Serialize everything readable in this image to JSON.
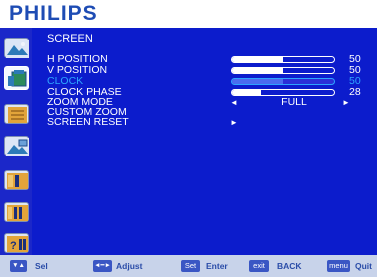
{
  "brand": "PHILIPS",
  "screen": {
    "title": "SCREEN",
    "rows": [
      {
        "label": "H POSITION",
        "value": "50",
        "fill_fraction": 0.5
      },
      {
        "label": "V POSITION",
        "value": "50",
        "fill_fraction": 0.5
      },
      {
        "label": "CLOCK",
        "value": "50",
        "fill_fraction": 0.5,
        "selected": true
      },
      {
        "label": "CLOCK PHASE",
        "value": "28",
        "fill_fraction": 0.28
      }
    ],
    "zoom_mode": {
      "label": "ZOOM MODE",
      "value": "FULL",
      "left_arrow": "◄",
      "right_arrow": "►"
    },
    "custom_zoom": {
      "label": "CUSTOM ZOOM"
    },
    "screen_reset": {
      "label": "SCREEN RESET",
      "arrow": "►"
    }
  },
  "sidebar": {
    "items": [
      {
        "name": "picture-icon"
      },
      {
        "name": "screen-icon",
        "active": true
      },
      {
        "name": "audio-icon"
      },
      {
        "name": "pip-icon"
      },
      {
        "name": "configuration1-icon"
      },
      {
        "name": "configuration2-icon"
      },
      {
        "name": "advanced-option-icon"
      }
    ]
  },
  "footer": {
    "sel_key": "▼▲",
    "sel_label": "Sel",
    "adjust_key": "◄━►",
    "adjust_label": "Adjust",
    "set_key": "Set",
    "enter_label": "Enter",
    "exit_key": "exit",
    "back_label": "BACK",
    "menu_key": "menu",
    "quit_label": "Quit"
  },
  "colors": {
    "background": "#0c1ccc",
    "selected": "#2ea4ff",
    "brand": "#1e4cb4",
    "footer": "#c8d3ea"
  }
}
